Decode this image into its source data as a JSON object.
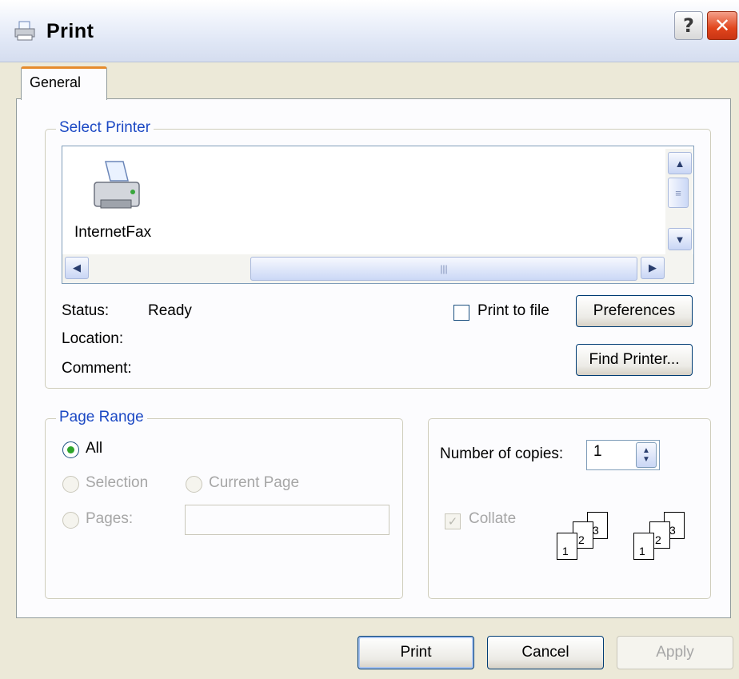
{
  "window": {
    "title": "Print",
    "help_button": "?",
    "close_button": "✕"
  },
  "tabs": [
    {
      "label": "General",
      "selected": true
    }
  ],
  "select_printer": {
    "legend": "Select Printer",
    "printers": [
      {
        "name": "InternetFax",
        "icon": "fax-printer-icon"
      }
    ],
    "status_label": "Status:",
    "status_value": "Ready",
    "location_label": "Location:",
    "location_value": "",
    "comment_label": "Comment:",
    "comment_value": "",
    "print_to_file_label": "Print to file",
    "print_to_file_checked": false,
    "preferences_button": "Preferences",
    "find_printer_button": "Find Printer..."
  },
  "page_range": {
    "legend": "Page Range",
    "all_label": "All",
    "selection_label": "Selection",
    "current_page_label": "Current Page",
    "pages_label": "Pages:",
    "pages_value": "",
    "selected": "All"
  },
  "copies": {
    "number_label": "Number of copies:",
    "number_value": "1",
    "collate_label": "Collate",
    "collate_checked": true,
    "collate_icon_pages": [
      "1",
      "2",
      "3"
    ]
  },
  "footer": {
    "print_button": "Print",
    "cancel_button": "Cancel",
    "apply_button": "Apply"
  },
  "colors": {
    "accent_legend": "#1c49c4",
    "tab_highlight": "#e68b2c",
    "close_red": "#e1451c"
  }
}
